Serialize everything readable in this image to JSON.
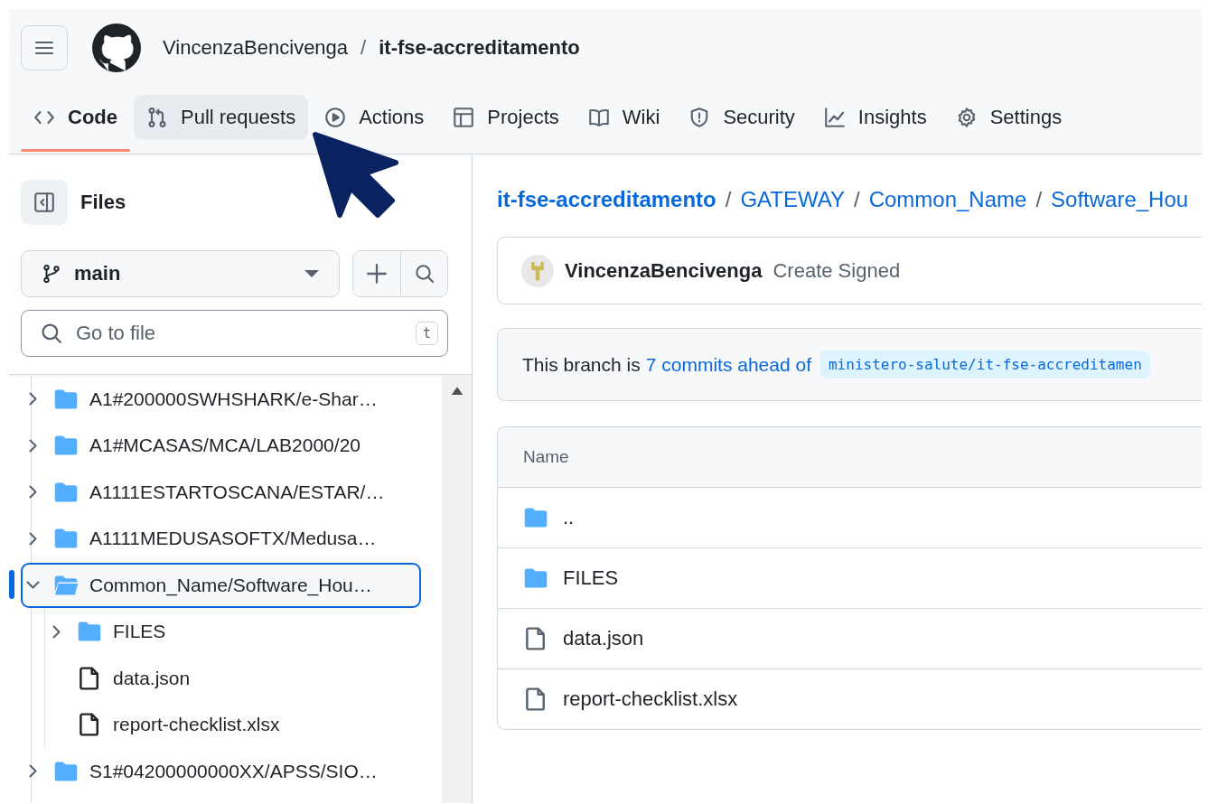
{
  "header": {
    "owner": "VincenzaBencivenga",
    "separator": "/",
    "repo": "it-fse-accreditamento"
  },
  "tabs": [
    {
      "label": "Code",
      "selected": true,
      "hovered": false
    },
    {
      "label": "Pull requests",
      "selected": false,
      "hovered": true
    },
    {
      "label": "Actions",
      "selected": false,
      "hovered": false
    },
    {
      "label": "Projects",
      "selected": false,
      "hovered": false
    },
    {
      "label": "Wiki",
      "selected": false,
      "hovered": false
    },
    {
      "label": "Security",
      "selected": false,
      "hovered": false
    },
    {
      "label": "Insights",
      "selected": false,
      "hovered": false
    },
    {
      "label": "Settings",
      "selected": false,
      "hovered": false
    }
  ],
  "sidebar": {
    "title": "Files",
    "branch": "main",
    "search": {
      "placeholder": "Go to file",
      "shortcut": "t"
    },
    "tree": [
      {
        "name": "A1#200000SWHSHARK/e-Shar…",
        "kind": "folder",
        "expanded": false,
        "selected": false
      },
      {
        "name": "A1#MCASAS/MCA/LAB2000/20",
        "kind": "folder",
        "expanded": false,
        "selected": false
      },
      {
        "name": "A1111ESTARTOSCANA/ESTAR/…",
        "kind": "folder",
        "expanded": false,
        "selected": false
      },
      {
        "name": "A1111MEDUSASOFTX/Medusa…",
        "kind": "folder",
        "expanded": false,
        "selected": false
      },
      {
        "name": "Common_Name/Software_Hou…",
        "kind": "folder",
        "expanded": true,
        "selected": true,
        "children": [
          {
            "name": "FILES",
            "kind": "folder",
            "expanded": false,
            "selected": false
          },
          {
            "name": "data.json",
            "kind": "file",
            "selected": false
          },
          {
            "name": "report-checklist.xlsx",
            "kind": "file",
            "selected": false
          }
        ]
      },
      {
        "name": "S1#04200000000XX/APSS/SIO…",
        "kind": "folder",
        "expanded": false,
        "selected": false
      }
    ]
  },
  "breadcrumb": [
    {
      "text": "it-fse-accreditamento",
      "kind": "link"
    },
    {
      "text": "/",
      "kind": "separator"
    },
    {
      "text": "GATEWAY",
      "kind": "link"
    },
    {
      "text": "/",
      "kind": "separator"
    },
    {
      "text": "Common_Name",
      "kind": "link"
    },
    {
      "text": "/",
      "kind": "separator"
    },
    {
      "text": "Software_Hou",
      "kind": "link"
    }
  ],
  "commit": {
    "author": "VincenzaBencivenga",
    "message": "Create Signed"
  },
  "branch_notice": {
    "text": "This branch is",
    "link": "7 commits ahead of",
    "ref": "ministero-salute/it-fse-accreditamen"
  },
  "table": {
    "columns": [
      "Name"
    ],
    "rows": [
      {
        "name": "..",
        "kind": "folder"
      },
      {
        "name": "FILES",
        "kind": "folder"
      },
      {
        "name": "data.json",
        "kind": "file"
      },
      {
        "name": "report-checklist.xlsx",
        "kind": "file"
      }
    ]
  }
}
